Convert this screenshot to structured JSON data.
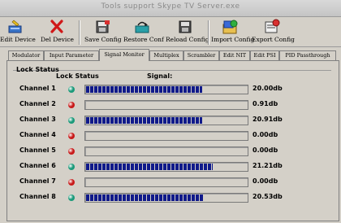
{
  "window": {
    "title": "Tools support Skype TV Server.exe"
  },
  "toolbar": {
    "buttons": [
      {
        "label": "Edit Device",
        "icon": "edit-device-icon"
      },
      {
        "label": "Del Device",
        "icon": "delete-x-icon"
      },
      {
        "label": "Save Config",
        "icon": "save-config-icon"
      },
      {
        "label": "Restore Conf",
        "icon": "restore-config-icon"
      },
      {
        "label": "Reload Config",
        "icon": "reload-config-icon"
      },
      {
        "label": "Import Config",
        "icon": "import-config-icon"
      },
      {
        "label": "Export Config",
        "icon": "export-config-icon"
      }
    ]
  },
  "tabs": [
    {
      "label": "Modulator"
    },
    {
      "label": "Input Parameter"
    },
    {
      "label": "Signal Monitor",
      "active": true
    },
    {
      "label": "Multiplex"
    },
    {
      "label": "Scrambler"
    },
    {
      "label": "Edit NIT"
    },
    {
      "label": "Edit PSI"
    },
    {
      "label": "PID Passthrough"
    }
  ],
  "panel": {
    "group_title": "Lock Status",
    "col_lock": "Lock Status",
    "col_signal": "Signal:",
    "colors": {
      "locked": "#1a9a7a",
      "unlocked": "#c81a1a",
      "bar": "#101a8a"
    },
    "channels": [
      {
        "name": "Channel 1",
        "locked": true,
        "level": 0.72,
        "value": "20.00db"
      },
      {
        "name": "Channel 2",
        "locked": false,
        "level": 0.0,
        "value": "0.91db"
      },
      {
        "name": "Channel 3",
        "locked": true,
        "level": 0.72,
        "value": "20.91db"
      },
      {
        "name": "Channel 4",
        "locked": false,
        "level": 0.0,
        "value": "0.00db"
      },
      {
        "name": "Channel 5",
        "locked": false,
        "level": 0.0,
        "value": "0.00db"
      },
      {
        "name": "Channel 6",
        "locked": true,
        "level": 0.79,
        "value": "21.21db"
      },
      {
        "name": "Channel 7",
        "locked": false,
        "level": 0.0,
        "value": "0.00db"
      },
      {
        "name": "Channel 8",
        "locked": true,
        "level": 0.73,
        "value": "20.53db"
      }
    ]
  }
}
